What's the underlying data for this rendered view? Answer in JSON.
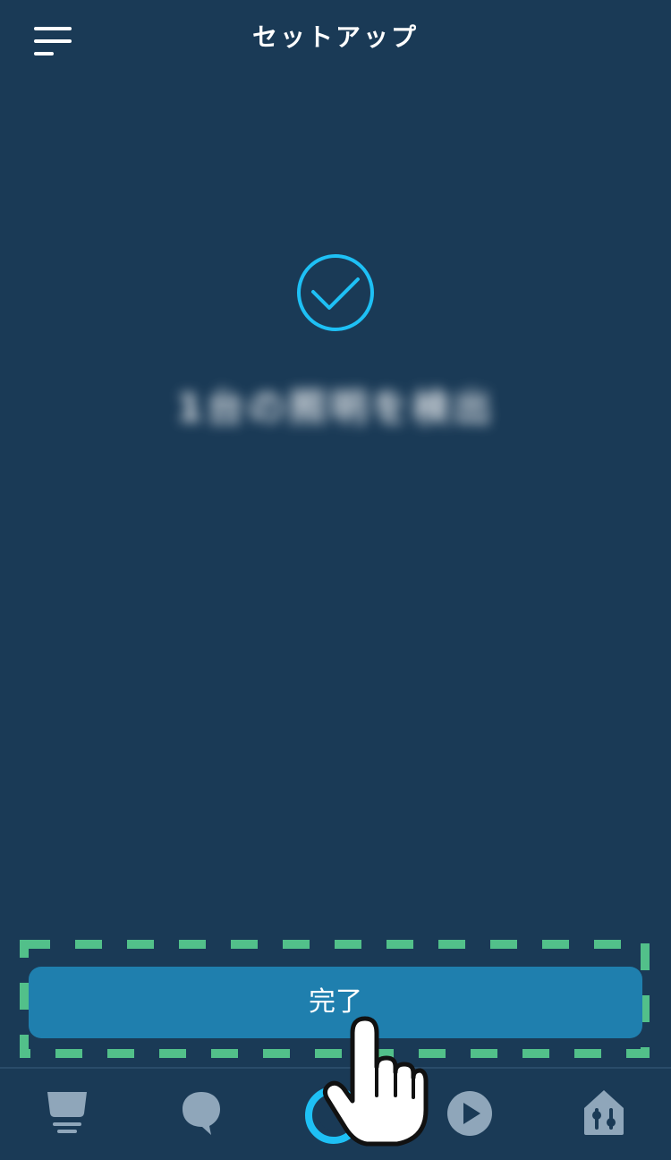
{
  "header": {
    "title": "セットアップ",
    "menu_icon": "hamburger-menu-icon"
  },
  "main": {
    "success_icon": "checkmark-circle-icon",
    "status_text": "1台の照明を検出"
  },
  "footer": {
    "done_label": "完了"
  },
  "bottom_nav": {
    "items": [
      {
        "name": "home",
        "icon": "home-screen-icon"
      },
      {
        "name": "communicate",
        "icon": "speech-bubble-icon"
      },
      {
        "name": "alexa",
        "icon": "alexa-ring-icon"
      },
      {
        "name": "play",
        "icon": "play-icon"
      },
      {
        "name": "devices",
        "icon": "smart-home-devices-icon"
      }
    ]
  },
  "colors": {
    "background": "#1a3a56",
    "accent": "#1ec0f5",
    "button": "#1f7fae",
    "highlight": "#52c08a",
    "nav_icon": "#8fa6ba"
  }
}
